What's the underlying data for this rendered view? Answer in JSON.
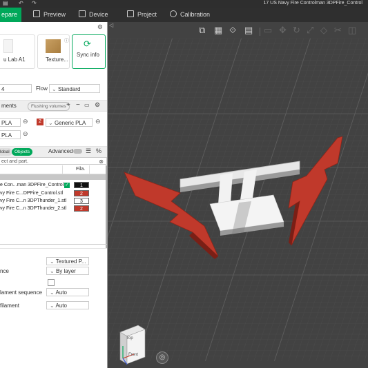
{
  "window": {
    "title": "17 US Navy Fire Controlman 3DPFire_Control"
  },
  "tabs": [
    {
      "label": "epare",
      "active": true
    },
    {
      "label": "Preview",
      "active": false
    },
    {
      "label": "Device",
      "active": false
    },
    {
      "label": "Project",
      "active": false
    },
    {
      "label": "Calibration",
      "active": false
    }
  ],
  "printer": {
    "name": "u Lab A1",
    "plate_label": "Texture...",
    "sync_label": "Sync info"
  },
  "settings_row": {
    "layer_value": "4",
    "flow_label": "Flow",
    "flow_value": "Standard"
  },
  "filaments": {
    "title": "ments",
    "flushing_label": "Flushing volumes",
    "items": [
      {
        "name": "PLA",
        "index": "",
        "color": "#ffffff"
      },
      {
        "name": "Generic PLA",
        "index": "2",
        "color": "#c0392b"
      },
      {
        "name": "PLA",
        "index": "",
        "color": "#ffffff"
      }
    ]
  },
  "objects_panel": {
    "global_label": "lobal",
    "objects_label": "Objects",
    "advanced_label": "Advanced",
    "search_placeholder": "ect and part.",
    "col_fila": "Fila.",
    "rows": [
      {
        "name": "e Con...man 3DPFire_Control",
        "fila": "1",
        "checked": true,
        "color": "#111111",
        "text_color": "#ffffff"
      },
      {
        "name": "vy Fire C...DPFire_Control.stl",
        "fila": "2",
        "checked": false,
        "color": "#c0392b",
        "text_color": "#ffffff"
      },
      {
        "name": "vy Fire C...n 3DPThunder_1.stl",
        "fila": "3",
        "checked": false,
        "color": "#ffffff",
        "text_color": "#111111"
      },
      {
        "name": "vy Fire C...n 3DPThunder_2.stl",
        "fila": "2",
        "checked": false,
        "color": "#c0392b",
        "text_color": "#ffffff"
      }
    ]
  },
  "process": {
    "rows": [
      {
        "label": "",
        "value": "Textured P..."
      },
      {
        "label": "nce",
        "value": "By layer"
      },
      {
        "label": "",
        "value": ""
      },
      {
        "label": "lament sequence",
        "value": "Auto"
      },
      {
        "label": "filament",
        "value": "Auto"
      }
    ]
  },
  "viewcube": {
    "top_label": "Top",
    "front_label": "Front"
  },
  "colors": {
    "accent": "#00a85a",
    "red_part": "#c0392b"
  }
}
